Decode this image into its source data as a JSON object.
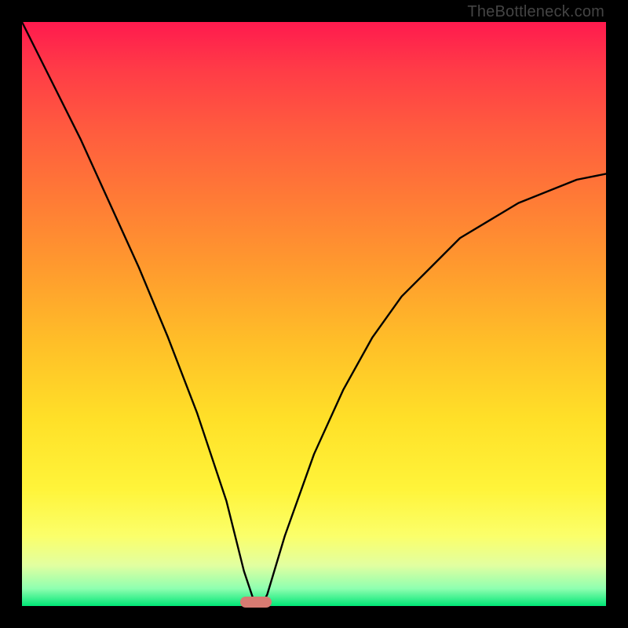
{
  "watermark": "TheBottleneck.com",
  "chart_data": {
    "type": "line",
    "title": "",
    "xlabel": "",
    "ylabel": "",
    "xlim": [
      0,
      100
    ],
    "ylim": [
      0,
      100
    ],
    "x": [
      0,
      5,
      10,
      15,
      20,
      25,
      30,
      35,
      38,
      40,
      41,
      42,
      45,
      50,
      55,
      60,
      65,
      70,
      75,
      80,
      85,
      90,
      95,
      100
    ],
    "values": [
      100,
      90,
      80,
      69,
      58,
      46,
      33,
      18,
      6,
      0,
      0,
      2,
      12,
      26,
      37,
      46,
      53,
      58,
      63,
      66,
      69,
      71,
      73,
      74
    ],
    "minimum_x": 40,
    "minimum_y": 0,
    "marker": {
      "x": 40,
      "y": 0,
      "color": "#d77b72"
    },
    "background_gradient_top": "#ff1a4e",
    "background_gradient_bottom": "#00e676",
    "curve_color": "#000000"
  }
}
